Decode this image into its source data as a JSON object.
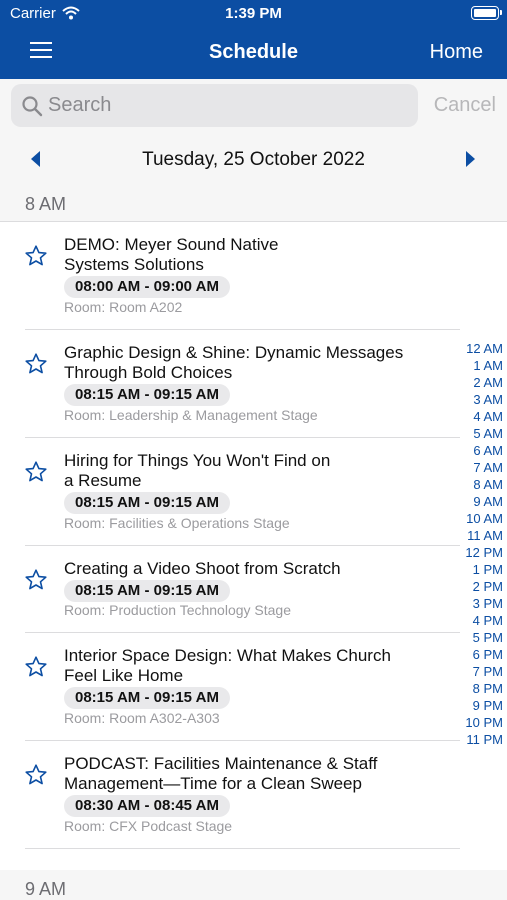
{
  "status_bar": {
    "carrier": "Carrier",
    "time": "1:39 PM"
  },
  "nav": {
    "title": "Schedule",
    "home_label": "Home"
  },
  "search": {
    "placeholder": "Search",
    "cancel_label": "Cancel"
  },
  "date_nav": {
    "date": "Tuesday, 25 October 2022"
  },
  "sections": [
    {
      "header": "8 AM",
      "sessions": [
        {
          "title_lines": [
            "DEMO: Meyer Sound Native",
            "Systems Solutions"
          ],
          "time": "08:00 AM - 09:00 AM",
          "room": "Room:  Room A202"
        },
        {
          "title_lines": [
            "Graphic Design & Shine: Dynamic Messages",
            "Through Bold Choices"
          ],
          "time": "08:15 AM - 09:15 AM",
          "room": "Room:  Leadership & Management Stage"
        },
        {
          "title_lines": [
            "Hiring for Things You Won't Find on",
            "a Resume"
          ],
          "time": "08:15 AM - 09:15 AM",
          "room": "Room:  Facilities & Operations Stage"
        },
        {
          "title_lines": [
            "Creating a Video Shoot from Scratch"
          ],
          "time": "08:15 AM - 09:15 AM",
          "room": "Room:  Production Technology Stage"
        },
        {
          "title_lines": [
            "Interior Space Design: What Makes Church",
            "Feel Like Home"
          ],
          "time": "08:15 AM - 09:15 AM",
          "room": "Room:  Room A302-A303"
        },
        {
          "title_lines": [
            "PODCAST: Facilities Maintenance & Staff",
            "Management—Time for a Clean Sweep"
          ],
          "time": "08:30 AM - 08:45 AM",
          "room": "Room:  CFX Podcast Stage"
        }
      ]
    },
    {
      "header": "9 AM",
      "sessions": []
    }
  ],
  "hour_index": [
    "12 AM",
    "1 AM",
    "2 AM",
    "3 AM",
    "4 AM",
    "5 AM",
    "6 AM",
    "7 AM",
    "8 AM",
    "9 AM",
    "10 AM",
    "11 AM",
    "12 PM",
    "1 PM",
    "2 PM",
    "3 PM",
    "4 PM",
    "5 PM",
    "6 PM",
    "7 PM",
    "8 PM",
    "9 PM",
    "10 PM",
    "11 PM"
  ],
  "colors": {
    "brand_blue": "#0c4ea3",
    "header_gray": "#f6f6f6",
    "pill_gray": "#e9e9eb"
  },
  "icons": {
    "menu": "hamburger-icon",
    "search": "search-icon",
    "favorite": "star-outline-icon",
    "prev": "caret-left-icon",
    "next": "caret-right-icon"
  }
}
